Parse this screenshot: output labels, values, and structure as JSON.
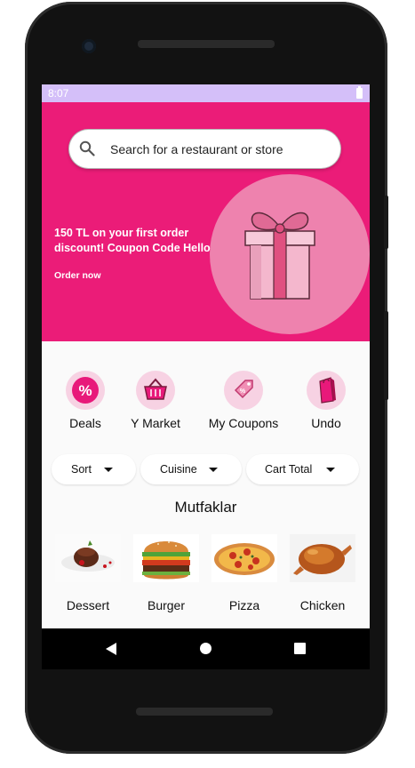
{
  "status": {
    "time": "8:07"
  },
  "search": {
    "placeholder": "Search for a restaurant or store"
  },
  "promo": {
    "text": "150 TL on your first order discount! Coupon Code Hello",
    "link": "Order now"
  },
  "categories": [
    {
      "label": "Deals",
      "icon": "percent-badge-icon"
    },
    {
      "label": "Y Market",
      "icon": "shopping-basket-icon"
    },
    {
      "label": "My Coupons",
      "icon": "coupon-tag-icon"
    },
    {
      "label": "Undo",
      "icon": "shopping-bag-icon"
    }
  ],
  "filters": [
    {
      "label": "Sort"
    },
    {
      "label": "Cuisine"
    },
    {
      "label": "Cart Total"
    }
  ],
  "section_title": "Mutfaklar",
  "foods": [
    {
      "label": "Dessert"
    },
    {
      "label": "Burger"
    },
    {
      "label": "Pizza"
    },
    {
      "label": "Chicken"
    }
  ],
  "colors": {
    "accent": "#eb1c78",
    "status_bar": "#d4bff9",
    "promo_circle": "#ee82ae"
  }
}
